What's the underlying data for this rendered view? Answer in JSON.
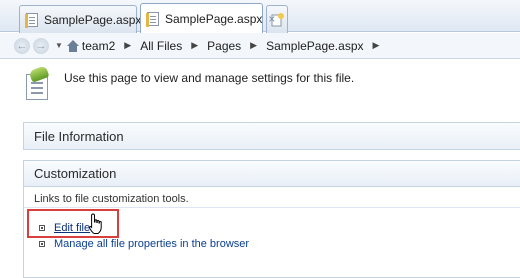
{
  "tabs": [
    {
      "label": "SamplePage.aspx",
      "state": "inactive"
    },
    {
      "label": "SamplePage.aspx",
      "state": "active",
      "close_label": "×"
    }
  ],
  "new_tab_icon": "new-page-icon",
  "breadcrumb": {
    "back_icon": "back-arrow-icon",
    "forward_icon": "forward-arrow-icon",
    "items": [
      "team2",
      "All Files",
      "Pages",
      "SamplePage.aspx"
    ]
  },
  "header": {
    "icon": "settings-page-icon",
    "text": "Use this page to view and manage settings for this file."
  },
  "sections": {
    "file_information": {
      "title": "File Information"
    },
    "customization": {
      "title": "Customization",
      "description": "Links to file customization tools.",
      "links": [
        "Edit file",
        "Manage all file properties in the browser"
      ]
    }
  },
  "colors": {
    "highlight": "#d8403e",
    "link": "#0b3f8e"
  }
}
